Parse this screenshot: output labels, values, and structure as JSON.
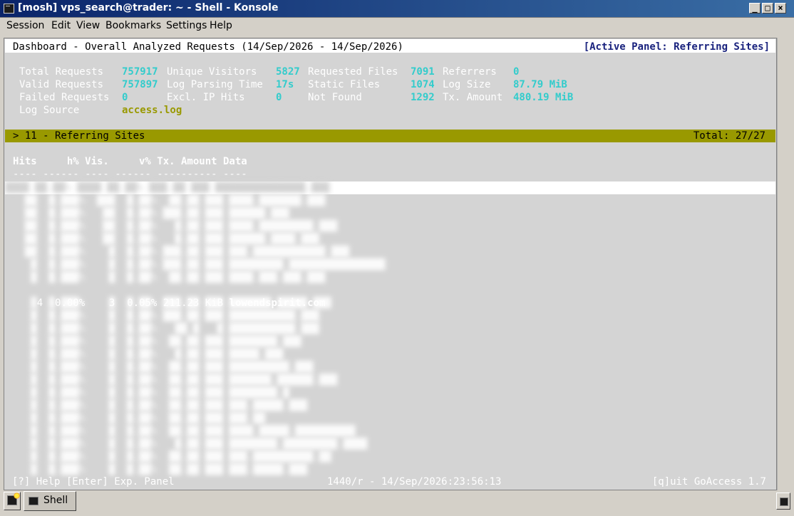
{
  "window": {
    "title": "[mosh] vps_search@trader: ~ - Shell - Konsole",
    "min": "_",
    "max": "□",
    "close": "×"
  },
  "menu": [
    "Session",
    "Edit",
    "View",
    "Bookmarks",
    "Settings",
    "Help"
  ],
  "header": {
    "left": "Dashboard - Overall Analyzed Requests (14/Sep/2026 - 14/Sep/2026)",
    "right": "[Active Panel: Referring Sites]"
  },
  "stats": {
    "total_requests_label": "Total Requests",
    "total_requests": "757917",
    "unique_visitors_label": "Unique Visitors",
    "unique_visitors": "5827",
    "requested_files_label": "Requested Files",
    "requested_files": "7091",
    "referrers_label": "Referrers",
    "referrers": "0",
    "valid_requests_label": "Valid Requests",
    "valid_requests": "757897",
    "log_parsing_time_label": "Log Parsing Time",
    "log_parsing_time": "17s",
    "static_files_label": "Static Files",
    "static_files": "1074",
    "log_size_label": "Log Size",
    "log_size": "87.79 MiB",
    "failed_requests_label": "Failed Requests",
    "failed_requests": "0",
    "excl_ip_hits_label": "Excl. IP Hits",
    "excl_ip_hits": "0",
    "not_found_label": "Not Found",
    "not_found": "1292",
    "tx_amount_label": "Tx. Amount",
    "tx_amount": "480.19 MiB",
    "log_source_label": "Log Source",
    "log_source": "access.log"
  },
  "panel": {
    "title": "> 11 - Referring Sites",
    "total": "Total: 27/27"
  },
  "table": {
    "columns": "Hits     h% Vis.     v% Tx. Amount Data",
    "dashes": "---- ------ ---- ------ ---------- ----",
    "visible_row": {
      "hits": "4",
      "hits_pct": "0.00%",
      "visitors": "3",
      "visitors_pct": "0.05%",
      "tx": "211.23 KiB",
      "data": "lowendspirit.com"
    }
  },
  "footer": {
    "left": "[?] Help [Enter] Exp. Panel",
    "middle": "1440/r - 14/Sep/2026:23:56:13",
    "right": "[q]uit GoAccess 1.7"
  },
  "tabs": {
    "shell_label": "Shell"
  }
}
